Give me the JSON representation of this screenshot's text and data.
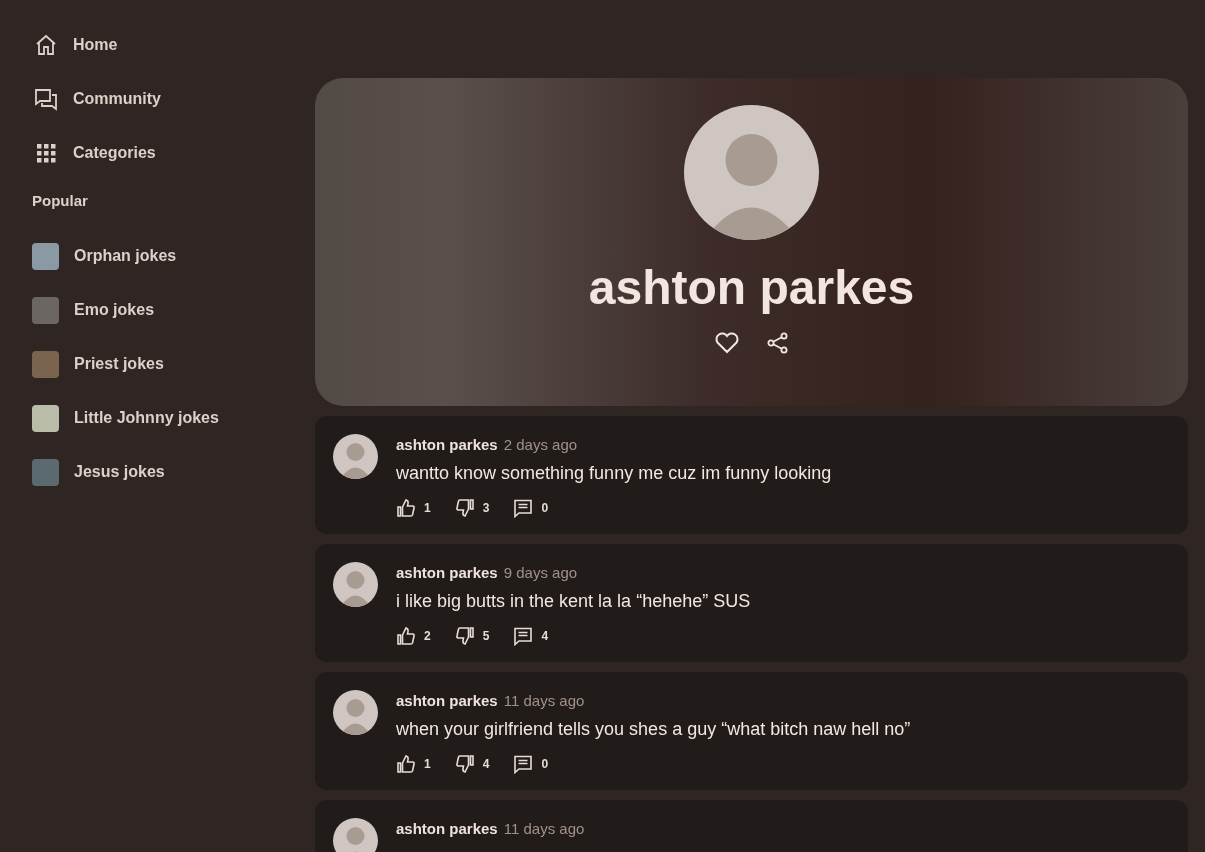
{
  "nav": [
    {
      "kind": "home",
      "label": "Home"
    },
    {
      "kind": "community",
      "label": "Community"
    },
    {
      "kind": "categories",
      "label": "Categories"
    }
  ],
  "popular_heading": "Popular",
  "popular": [
    {
      "label": "Orphan jokes",
      "color": "#8a99a3"
    },
    {
      "label": "Emo jokes",
      "color": "#6b6662"
    },
    {
      "label": "Priest jokes",
      "color": "#7a6450"
    },
    {
      "label": "Little Johnny jokes",
      "color": "#b9bca8"
    },
    {
      "label": "Jesus jokes",
      "color": "#5b6a6e"
    }
  ],
  "profile": {
    "name": "ashton parkes"
  },
  "posts": [
    {
      "author": "ashton parkes",
      "time": "2 days ago",
      "text": "wantto know something funny me cuz im funny looking",
      "likes": "1",
      "dislikes": "3",
      "comments": "0"
    },
    {
      "author": "ashton parkes",
      "time": "9 days ago",
      "text": "i like big butts in the kent la la “hehehe” SUS",
      "likes": "2",
      "dislikes": "5",
      "comments": "4"
    },
    {
      "author": "ashton parkes",
      "time": "11 days ago",
      "text": "when your girlfriend tells you shes a guy “what bitch naw hell no”",
      "likes": "1",
      "dislikes": "4",
      "comments": "0"
    },
    {
      "author": "ashton parkes",
      "time": "11 days ago"
    }
  ]
}
